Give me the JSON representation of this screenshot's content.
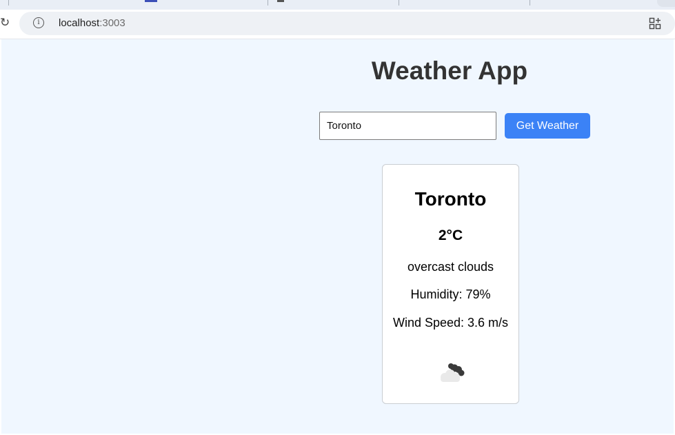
{
  "browser": {
    "url_host": "localhost",
    "url_port": ":3003"
  },
  "app": {
    "title": "Weather App"
  },
  "search": {
    "value": "Toronto",
    "button_label": "Get Weather"
  },
  "weather": {
    "city": "Toronto",
    "temperature": "2°C",
    "description": "overcast clouds",
    "humidity": "Humidity: 79%",
    "wind_speed": "Wind Speed: 3.6 m/s",
    "icon": "overcast-clouds-icon"
  },
  "colors": {
    "page_background": "#f0f7ff",
    "button": "#3b82f6",
    "title": "#333333"
  }
}
